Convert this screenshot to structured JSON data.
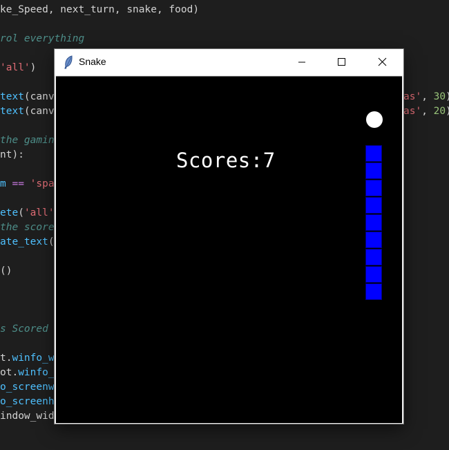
{
  "editor": {
    "lines": [
      [
        {
          "t": "ke_Speed, next_turn, snake, food)",
          "c": "plain"
        }
      ],
      [],
      [
        {
          "t": "rol everything",
          "c": "comment"
        }
      ],
      [],
      [
        {
          "t": "'all'",
          "c": "string"
        },
        {
          "t": ")",
          "c": "plain"
        }
      ],
      [],
      [
        {
          "t": "text",
          "c": "func"
        },
        {
          "t": "(canv",
          "c": "plain"
        }
      ],
      [
        {
          "t": "text",
          "c": "func"
        },
        {
          "t": "(canv",
          "c": "plain"
        }
      ],
      [],
      [
        {
          "t": "the gamin",
          "c": "comment"
        }
      ],
      [
        {
          "t": "nt):",
          "c": "plain"
        }
      ],
      [],
      [
        {
          "t": "m ",
          "c": "func"
        },
        {
          "t": "==",
          "c": "keyword"
        },
        {
          "t": " 'spa",
          "c": "string"
        }
      ],
      [],
      [
        {
          "t": "ete",
          "c": "func"
        },
        {
          "t": "(",
          "c": "plain"
        },
        {
          "t": "'all'",
          "c": "string"
        }
      ],
      [
        {
          "t": "the score",
          "c": "comment"
        }
      ],
      [
        {
          "t": "ate_text",
          "c": "func"
        },
        {
          "t": "(",
          "c": "plain"
        }
      ],
      [],
      [
        {
          "t": "()",
          "c": "plain"
        }
      ],
      [],
      [],
      [],
      [
        {
          "t": "s Scored",
          "c": "comment"
        }
      ],
      [],
      [
        {
          "t": "t.",
          "c": "plain"
        },
        {
          "t": "winfo_w",
          "c": "func"
        }
      ],
      [
        {
          "t": "ot.",
          "c": "plain"
        },
        {
          "t": "winfo_",
          "c": "func"
        }
      ],
      [
        {
          "t": "o_screenw",
          "c": "func"
        }
      ],
      [
        {
          "t": "o_screenh",
          "c": "func"
        }
      ],
      [
        {
          "t": "indow_widt",
          "c": "plain"
        }
      ]
    ],
    "right_lines": [
      {
        "line": 6,
        "tokens": [
          {
            "t": "as'",
            "c": "string"
          },
          {
            "t": ", ",
            "c": "plain"
          },
          {
            "t": "30",
            "c": "number"
          },
          {
            "t": ")",
            "c": "plain"
          }
        ]
      },
      {
        "line": 7,
        "tokens": [
          {
            "t": "as'",
            "c": "string"
          },
          {
            "t": ", ",
            "c": "plain"
          },
          {
            "t": "20",
            "c": "number"
          },
          {
            "t": ")",
            "c": "plain"
          }
        ]
      }
    ]
  },
  "window": {
    "title": "Snake",
    "icon": "feather-icon",
    "controls": [
      "minimize-icon",
      "maximize-icon",
      "close-icon"
    ]
  },
  "game": {
    "score_text": "Scores:7",
    "food_color": "#ffffff",
    "snake_color": "#0000ff",
    "snake_length": 9,
    "background": "#000000"
  }
}
